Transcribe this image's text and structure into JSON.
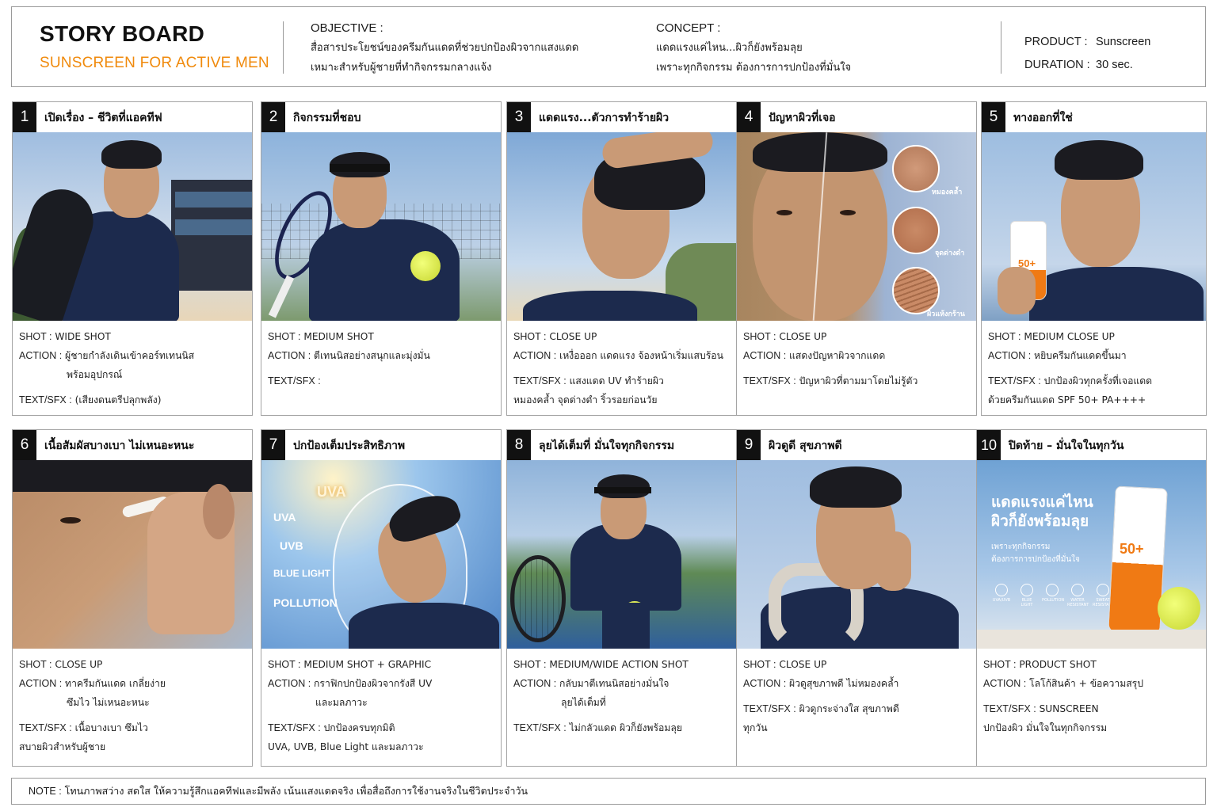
{
  "header": {
    "title": "STORY BOARD",
    "subtitle": "SUNSCREEN FOR ACTIVE MEN",
    "objective_label": "OBJECTIVE :",
    "objective_line1": "สื่อสารประโยชน์ของครีมกันแดดที่ช่วยปกป้องผิวจากแสงแดด",
    "objective_line2": "เหมาะสำหรับผู้ชายที่ทำกิจกรรมกลางแจ้ง",
    "concept_label": "CONCEPT :",
    "concept_line1": "แดดแรงแค่ไหน...ผิวก็ยังพร้อมลุย",
    "concept_line2": "เพราะทุกกิจกรรม ต้องการการปกป้องที่มั่นใจ",
    "product_label": "PRODUCT :",
    "product_value": "Sunscreen",
    "duration_label": "DURATION :",
    "duration_value": "30 sec."
  },
  "panels": [
    {
      "num": "1",
      "title": "เปิดเรื่อง – ชีวิตที่แอคทีฟ",
      "shot_label": "SHOT :",
      "shot": "WIDE SHOT",
      "action_label": "ACTION :",
      "action1": "ผู้ชายกำลังเดินเข้าคอร์ทเทนนิส",
      "action2": "พร้อมอุปกรณ์",
      "text_label": "TEXT/SFX :",
      "text1": "(เสียงดนตรีปลุกพลัง)",
      "text2": ""
    },
    {
      "num": "2",
      "title": "กิจกรรมที่ชอบ",
      "shot_label": "SHOT :",
      "shot": "MEDIUM SHOT",
      "action_label": "ACTION :",
      "action1": "ตีเทนนิสอย่างสนุกและมุ่งมั่น",
      "action2": "",
      "text_label": "TEXT/SFX :",
      "text1": "",
      "text2": ""
    },
    {
      "num": "3",
      "title": "แดดแรง...ตัวการทำร้ายผิว",
      "shot_label": "SHOT :",
      "shot": "CLOSE UP",
      "action_label": "ACTION :",
      "action1": "เหงื่อออก แดดแรง จ้องหน้าเริ่มแสบร้อน",
      "action2": "",
      "text_label": "TEXT/SFX :",
      "text1": "แสงแดด UV ทำร้ายผิว",
      "text2": "หมองคล้ำ จุดด่างดำ ริ้วรอยก่อนวัย"
    },
    {
      "num": "4",
      "title": "ปัญหาผิวที่เจอ",
      "shot_label": "SHOT :",
      "shot": "CLOSE UP",
      "action_label": "ACTION :",
      "action1": "แสดงปัญหาผิวจากแดด",
      "action2": "",
      "text_label": "TEXT/SFX :",
      "text1": "ปัญหาผิวที่ตามมาโดยไม่รู้ตัว",
      "text2": "",
      "labels": [
        "หมองคล้ำ",
        "จุดด่างดำ",
        "ผิวแห้งกร้าน"
      ]
    },
    {
      "num": "5",
      "title": "ทางออกที่ใช่",
      "shot_label": "SHOT :",
      "shot": "MEDIUM CLOSE UP",
      "action_label": "ACTION :",
      "action1": "หยิบครีมกันแดดขึ้นมา",
      "action2": "",
      "text_label": "TEXT/SFX :",
      "text1": "ปกป้องผิวทุกครั้งที่เจอแดด",
      "text2": "ด้วยครีมกันแดด SPF 50+ PA++++",
      "bottle_spf": "50+"
    },
    {
      "num": "6",
      "title": "เนื้อสัมผัสบางเบา ไม่เหนอะหนะ",
      "shot_label": "SHOT :",
      "shot": "CLOSE UP",
      "action_label": "ACTION :",
      "action1": "ทาครีมกันแดด เกลี่ยง่าย",
      "action2": "ซึมไว ไม่เหนอะหนะ",
      "text_label": "TEXT/SFX :",
      "text1": "เนื้อบางเบา ซึมไว",
      "text2": "สบายผิวสำหรับผู้ชาย"
    },
    {
      "num": "7",
      "title": "ปกป้องเต็มประสิทธิภาพ",
      "shot_label": "SHOT :",
      "shot": "MEDIUM SHOT + GRAPHIC",
      "action_label": "ACTION :",
      "action1": "กราฟิกปกป้องผิวจากรังสี UV",
      "action2": "และมลภาวะ",
      "text_label": "TEXT/SFX :",
      "text1": "ปกป้องครบทุกมิติ",
      "text2": "UVA, UVB, Blue Light และมลภาวะ",
      "graphic": [
        "UVA",
        "UVA",
        "UVB",
        "BLUE LIGHT",
        "POLLUTION"
      ]
    },
    {
      "num": "8",
      "title": "ลุยได้เต็มที่ มั่นใจทุกกิจกรรม",
      "shot_label": "SHOT :",
      "shot": "MEDIUM/WIDE ACTION SHOT",
      "action_label": "ACTION :",
      "action1": "กลับมาตีเทนนิสอย่างมั่นใจ",
      "action2": "ลุยได้เต็มที่",
      "text_label": "TEXT/SFX :",
      "text1": "ไม่กลัวแดด ผิวก็ยังพร้อมลุย",
      "text2": ""
    },
    {
      "num": "9",
      "title": "ผิวดูดี สุขภาพดี",
      "shot_label": "SHOT :",
      "shot": "CLOSE UP",
      "action_label": "ACTION :",
      "action1": "ผิวดูสุขภาพดี ไม่หมองคล้ำ",
      "action2": "",
      "text_label": "TEXT/SFX :",
      "text1": "ผิวดูกระจ่างใส สุขภาพดี",
      "text2": "ทุกวัน"
    },
    {
      "num": "10",
      "title": "ปิดท้าย – มั่นใจในทุกวัน",
      "shot_label": "SHOT :",
      "shot": "PRODUCT SHOT",
      "action_label": "ACTION :",
      "action1": "โลโก้สินค้า + ข้อความสรุป",
      "action2": "",
      "text_label": "TEXT/SFX :",
      "text1": "SUNSCREEN",
      "text2": "ปกป้องผิว มั่นใจในทุกกิจกรรม",
      "ad_line1": "แดดแรงแค่ไหน",
      "ad_line2": "ผิวก็ยังพร้อมลุย",
      "ad_sub1": "เพราะทุกกิจกรรม",
      "ad_sub2": "ต้องการการปกป้องที่มั่นใจ",
      "ad_icons": [
        "UVA/UVB",
        "BLUE LIGHT",
        "POLLUTION",
        "WATER RESISTANT",
        "SWEAT RESISTANT"
      ],
      "bottle_spf": "50+"
    }
  ],
  "note": {
    "label": "NOTE :",
    "text": "โทนภาพสว่าง สดใส ให้ความรู้สึกแอคทีฟและมีพลัง เน้นแสงแดดจริง เพื่อสื่อถึงการใช้งานจริงในชีวิตประจำวัน"
  }
}
